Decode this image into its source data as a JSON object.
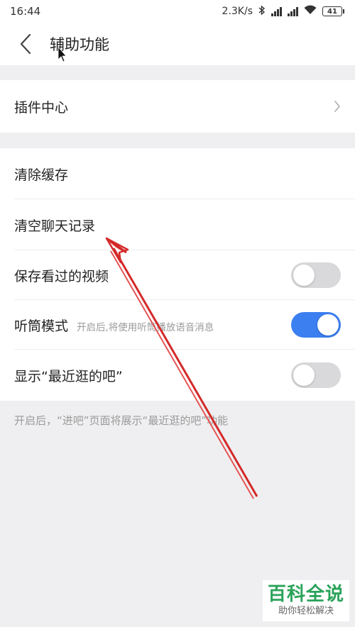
{
  "status_bar": {
    "time": "16:44",
    "speed": "2.3K/s",
    "battery": "41",
    "icons": [
      "bluetooth-icon",
      "signal-icon",
      "signal-icon",
      "wifi-icon",
      "battery-icon"
    ]
  },
  "header": {
    "back_icon": "chevron-left-icon",
    "title": "辅助功能"
  },
  "groups": {
    "plugin": {
      "label": "插件中心",
      "chevron_icon": "chevron-right-icon"
    },
    "settings": {
      "clear_cache": "清除缓存",
      "clear_chat": "清空聊天记录",
      "save_video": {
        "label": "保存看过的视频",
        "on": false
      },
      "earpiece": {
        "label": "听筒模式",
        "sub": "开启后,将使用听筒播放语音消息",
        "on": true
      },
      "recent_bars": {
        "label": "显示“最近逛的吧”",
        "on": false
      }
    }
  },
  "footnote": "开启后，“进吧”页面将展示“最近逛的吧”功能",
  "watermark": {
    "title": "百科全说",
    "subtitle": "助你轻松解决"
  },
  "colors": {
    "toggle_on": "#3b7ff0",
    "toggle_off": "#d9d9db",
    "annotation_arrow": "#d42a2a",
    "watermark_green": "#2aa35a",
    "background": "#efeff1"
  }
}
